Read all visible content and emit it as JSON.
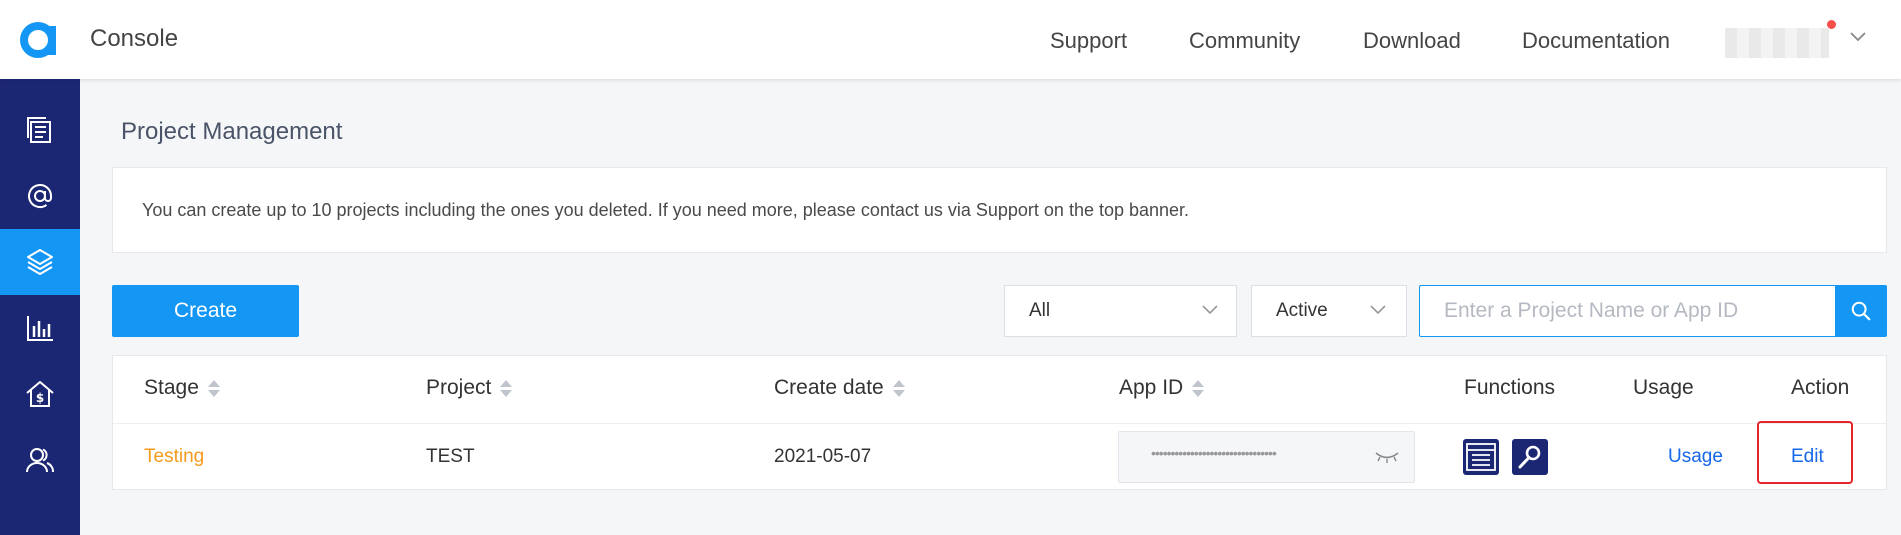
{
  "header": {
    "title": "Console",
    "nav": [
      "Support",
      "Community",
      "Download",
      "Documentation"
    ],
    "brand_color": "#1496f5"
  },
  "sidebar": {
    "items": [
      {
        "icon": "projects-list-icon"
      },
      {
        "icon": "at-sign-icon"
      },
      {
        "icon": "layers-icon",
        "active": true
      },
      {
        "icon": "bar-chart-icon"
      },
      {
        "icon": "billing-house-icon"
      },
      {
        "icon": "users-icon"
      }
    ],
    "bg_color": "#1c2774",
    "active_color": "#1496f5"
  },
  "main": {
    "title": "Project Management",
    "notice": "You can create up to 10 projects including the ones you deleted. If you need more, please contact us via Support on the top banner.",
    "create_label": "Create",
    "filter_stage": "All",
    "filter_status": "Active",
    "search_placeholder": "Enter a Project Name or App ID"
  },
  "table": {
    "headers": {
      "stage": "Stage",
      "project": "Project",
      "create_date": "Create date",
      "app_id": "App ID",
      "functions": "Functions",
      "usage": "Usage",
      "action": "Action"
    },
    "rows": [
      {
        "stage": "Testing",
        "project": "TEST",
        "create_date": "2021-05-07",
        "app_id_masked": "••••••••••••••••••••••••••••••••",
        "usage": "Usage",
        "action": "Edit"
      }
    ]
  }
}
